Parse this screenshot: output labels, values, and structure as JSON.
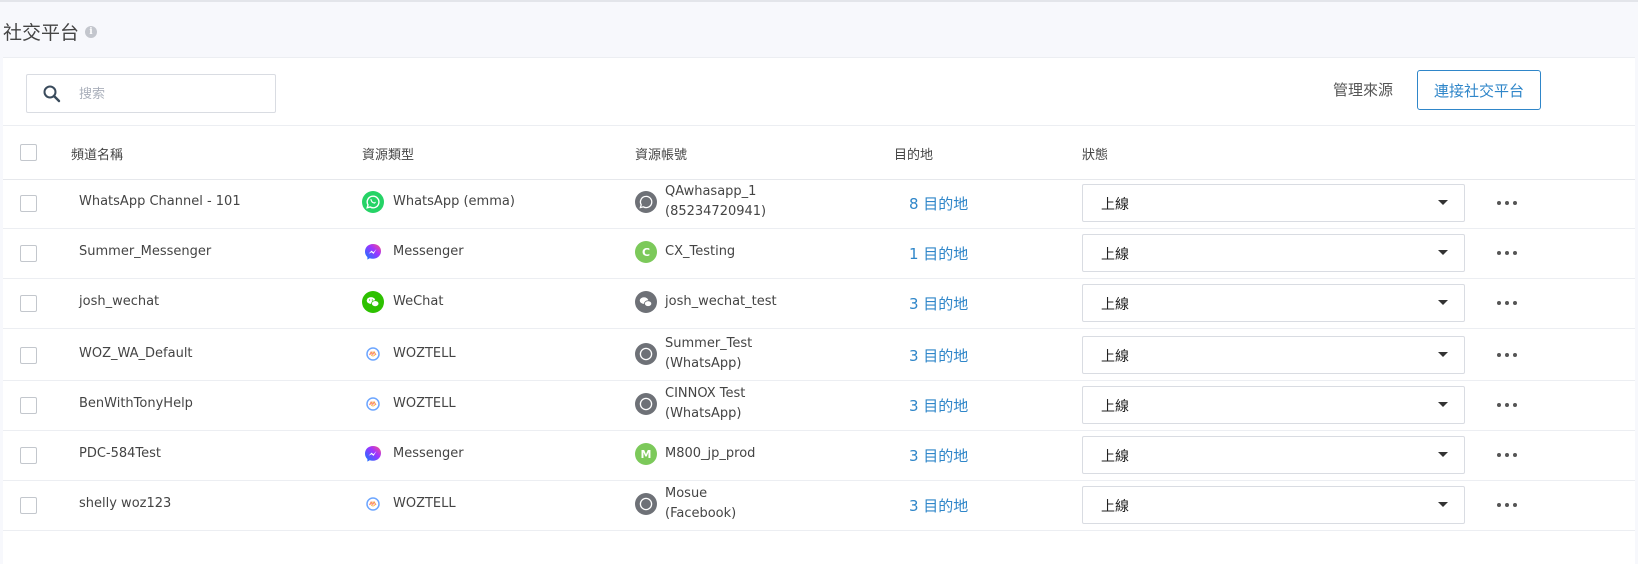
{
  "page": {
    "title": "社交平台"
  },
  "toolbar": {
    "search_placeholder": "搜索",
    "manage_label": "管理來源",
    "connect_label": "連接社交平台"
  },
  "table": {
    "columns": [
      "頻道名稱",
      "資源類型",
      "資源帳號",
      "目的地",
      "狀態"
    ],
    "rows": [
      {
        "channel": "WhatsApp Channel - 101",
        "type_icon": "whatsapp-icon",
        "type": "WhatsApp (emma)",
        "account_icon": "whatsapp-icon",
        "account_line1": "QAwhasapp_1",
        "account_line2": "(85234720941)",
        "dest": "8 目的地",
        "status": "上線"
      },
      {
        "channel": "Summer_Messenger",
        "type_icon": "messenger-icon",
        "type": "Messenger",
        "account_icon": "avatar-letter-icon",
        "account_letter": "C",
        "account_line1": "CX_Testing",
        "account_line2": "",
        "dest": "1 目的地",
        "status": "上線"
      },
      {
        "channel": "josh_wechat",
        "type_icon": "wechat-icon",
        "type": "WeChat",
        "account_icon": "wechat-icon",
        "account_line1": "josh_wechat_test",
        "account_line2": "",
        "dest": "3 目的地",
        "status": "上線"
      },
      {
        "channel": "WOZ_WA_Default",
        "type_icon": "woztell-icon",
        "type": "WOZTELL",
        "account_icon": "woztell-icon",
        "account_line1": "Summer_Test",
        "account_line2": "(WhatsApp)",
        "dest": "3 目的地",
        "status": "上線"
      },
      {
        "channel": "BenWithTonyHelp",
        "type_icon": "woztell-icon",
        "type": "WOZTELL",
        "account_icon": "woztell-icon",
        "account_line1": "CINNOX Test",
        "account_line2": "(WhatsApp)",
        "dest": "3 目的地",
        "status": "上線"
      },
      {
        "channel": "PDC-584Test",
        "type_icon": "messenger-icon",
        "type": "Messenger",
        "account_icon": "avatar-letter-icon",
        "account_letter": "M",
        "account_line1": "M800_jp_prod",
        "account_line2": "",
        "dest": "3 目的地",
        "status": "上線"
      },
      {
        "channel": "shelly woz123",
        "type_icon": "woztell-icon",
        "type": "WOZTELL",
        "account_icon": "woztell-icon",
        "account_line1": "Mosue",
        "account_line2": "(Facebook)",
        "dest": "3 目的地",
        "status": "上線"
      }
    ]
  },
  "colors": {
    "accent": "#2f86c9",
    "whatsapp": "#25d366",
    "wechat": "#2dc100",
    "avatar_green": "#7cc95a",
    "account_gray": "#6e7177"
  }
}
